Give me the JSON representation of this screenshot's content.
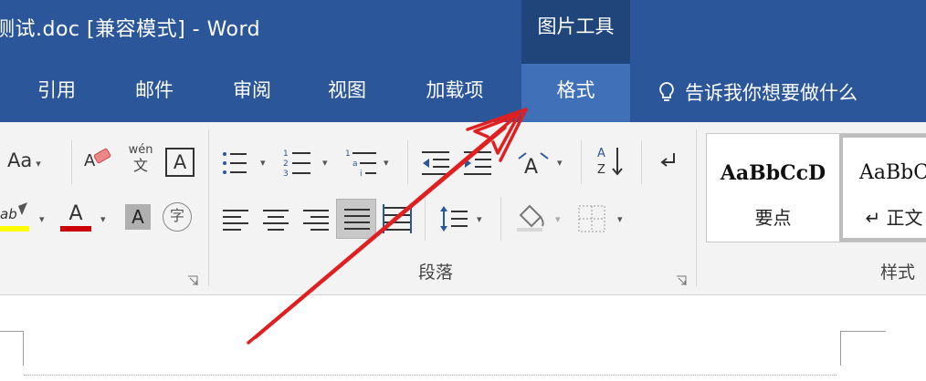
{
  "window": {
    "title": "测试.doc [兼容模式]  -  Word",
    "context_tab_group": "图片工具"
  },
  "tabs": {
    "references": "引用",
    "mailings": "邮件",
    "review": "审阅",
    "view": "视图",
    "addins": "加载项",
    "format": "格式"
  },
  "tell_me": {
    "placeholder": "告诉我你想要做什么",
    "icon": "lightbulb-icon"
  },
  "font_group": {
    "change_case_label": "Aa",
    "phonetic_top": "wén",
    "phonetic_bottom": "文",
    "char_border_label": "A",
    "font_color_label": "A",
    "char_shading_label": "A",
    "enclose_char_label": "字",
    "highlight_label": "ab",
    "colors": {
      "highlight": "#ffff00",
      "font_color": "#cc0000",
      "shading": "#b0b0b0"
    }
  },
  "paragraph_group": {
    "label": "段落"
  },
  "styles_group": {
    "label": "样式",
    "items": [
      {
        "preview": "AaBbCcD",
        "name": "要点"
      },
      {
        "preview": "AaBbC",
        "name": "↵ 正文"
      }
    ]
  },
  "annotation": {
    "color": "#e02020"
  }
}
